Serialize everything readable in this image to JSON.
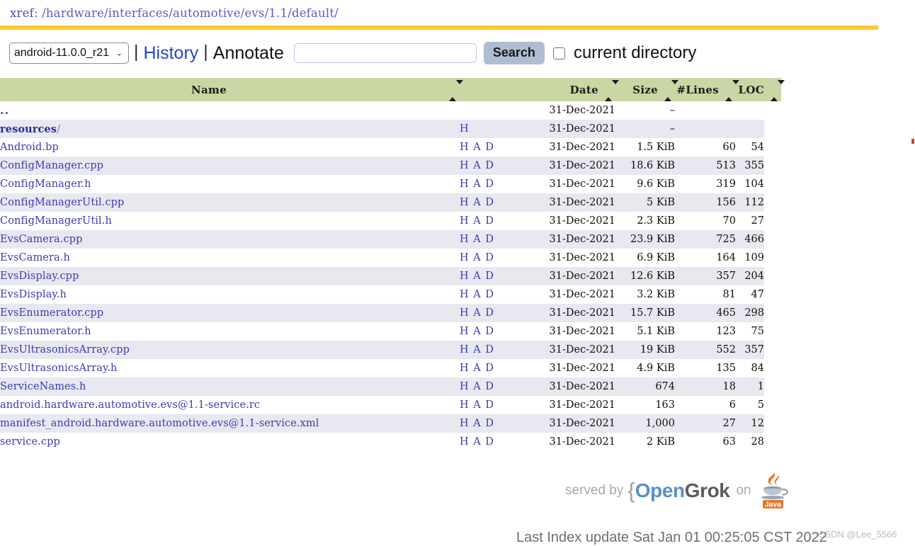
{
  "xref": {
    "label": "xref:",
    "path": "/hardware/interfaces/automotive/evs/1.1/default/",
    "accent_color": "#ffc62f"
  },
  "toolbar": {
    "project_selected": "android-11.0.0_r21",
    "project_options": [
      "android-11.0.0_r21"
    ],
    "chevron": "⌄",
    "separator": "|",
    "history_label": "History",
    "annotate_label": "Annotate",
    "search_value": "",
    "search_placeholder": "",
    "search_button_label": "Search",
    "current_directory_label": "current directory",
    "current_directory_checked": false
  },
  "table": {
    "headers": {
      "name": "Name",
      "date": "Date",
      "size": "Size",
      "lines": "#Lines",
      "loc": "LOC"
    },
    "rows": [
      {
        "name": "..",
        "is_updir": true,
        "is_dir": false,
        "hads": "",
        "date": "31-Dec-2021",
        "size": "–",
        "lines": "",
        "loc": ""
      },
      {
        "name": "resources",
        "is_updir": false,
        "is_dir": true,
        "hads": "H",
        "date": "31-Dec-2021",
        "size": "–",
        "lines": "",
        "loc": ""
      },
      {
        "name": "Android.bp",
        "is_updir": false,
        "is_dir": false,
        "hads": "H A D",
        "date": "31-Dec-2021",
        "size": "1.5 KiB",
        "lines": "60",
        "loc": "54"
      },
      {
        "name": "ConfigManager.cpp",
        "is_updir": false,
        "is_dir": false,
        "hads": "H A D",
        "date": "31-Dec-2021",
        "size": "18.6 KiB",
        "lines": "513",
        "loc": "355"
      },
      {
        "name": "ConfigManager.h",
        "is_updir": false,
        "is_dir": false,
        "hads": "H A D",
        "date": "31-Dec-2021",
        "size": "9.6 KiB",
        "lines": "319",
        "loc": "104"
      },
      {
        "name": "ConfigManagerUtil.cpp",
        "is_updir": false,
        "is_dir": false,
        "hads": "H A D",
        "date": "31-Dec-2021",
        "size": "5 KiB",
        "lines": "156",
        "loc": "112"
      },
      {
        "name": "ConfigManagerUtil.h",
        "is_updir": false,
        "is_dir": false,
        "hads": "H A D",
        "date": "31-Dec-2021",
        "size": "2.3 KiB",
        "lines": "70",
        "loc": "27"
      },
      {
        "name": "EvsCamera.cpp",
        "is_updir": false,
        "is_dir": false,
        "hads": "H A D",
        "date": "31-Dec-2021",
        "size": "23.9 KiB",
        "lines": "725",
        "loc": "466"
      },
      {
        "name": "EvsCamera.h",
        "is_updir": false,
        "is_dir": false,
        "hads": "H A D",
        "date": "31-Dec-2021",
        "size": "6.9 KiB",
        "lines": "164",
        "loc": "109"
      },
      {
        "name": "EvsDisplay.cpp",
        "is_updir": false,
        "is_dir": false,
        "hads": "H A D",
        "date": "31-Dec-2021",
        "size": "12.6 KiB",
        "lines": "357",
        "loc": "204"
      },
      {
        "name": "EvsDisplay.h",
        "is_updir": false,
        "is_dir": false,
        "hads": "H A D",
        "date": "31-Dec-2021",
        "size": "3.2 KiB",
        "lines": "81",
        "loc": "47"
      },
      {
        "name": "EvsEnumerator.cpp",
        "is_updir": false,
        "is_dir": false,
        "hads": "H A D",
        "date": "31-Dec-2021",
        "size": "15.7 KiB",
        "lines": "465",
        "loc": "298"
      },
      {
        "name": "EvsEnumerator.h",
        "is_updir": false,
        "is_dir": false,
        "hads": "H A D",
        "date": "31-Dec-2021",
        "size": "5.1 KiB",
        "lines": "123",
        "loc": "75"
      },
      {
        "name": "EvsUltrasonicsArray.cpp",
        "is_updir": false,
        "is_dir": false,
        "hads": "H A D",
        "date": "31-Dec-2021",
        "size": "19 KiB",
        "lines": "552",
        "loc": "357"
      },
      {
        "name": "EvsUltrasonicsArray.h",
        "is_updir": false,
        "is_dir": false,
        "hads": "H A D",
        "date": "31-Dec-2021",
        "size": "4.9 KiB",
        "lines": "135",
        "loc": "84"
      },
      {
        "name": "ServiceNames.h",
        "is_updir": false,
        "is_dir": false,
        "hads": "H A D",
        "date": "31-Dec-2021",
        "size": "674",
        "lines": "18",
        "loc": "1"
      },
      {
        "name": "android.hardware.automotive.evs@1.1-service.rc",
        "is_updir": false,
        "is_dir": false,
        "hads": "H A D",
        "date": "31-Dec-2021",
        "size": "163",
        "lines": "6",
        "loc": "5"
      },
      {
        "name": "manifest_android.hardware.automotive.evs@1.1-service.xml",
        "is_updir": false,
        "is_dir": false,
        "hads": "H A D",
        "date": "31-Dec-2021",
        "size": "1,000",
        "lines": "27",
        "loc": "12"
      },
      {
        "name": "service.cpp",
        "is_updir": false,
        "is_dir": false,
        "hads": "H A D",
        "date": "31-Dec-2021",
        "size": "2 KiB",
        "lines": "63",
        "loc": "28"
      }
    ]
  },
  "footer": {
    "served_by": "served by",
    "brace": "{",
    "brand_open": "Open",
    "brand_grok": "Grok",
    "on": "on",
    "java_label": "Java",
    "last_index_update": "Last Index update Sat Jan 01 00:25:05 CST 2022",
    "watermark": "CSDN @Lee_5566"
  }
}
